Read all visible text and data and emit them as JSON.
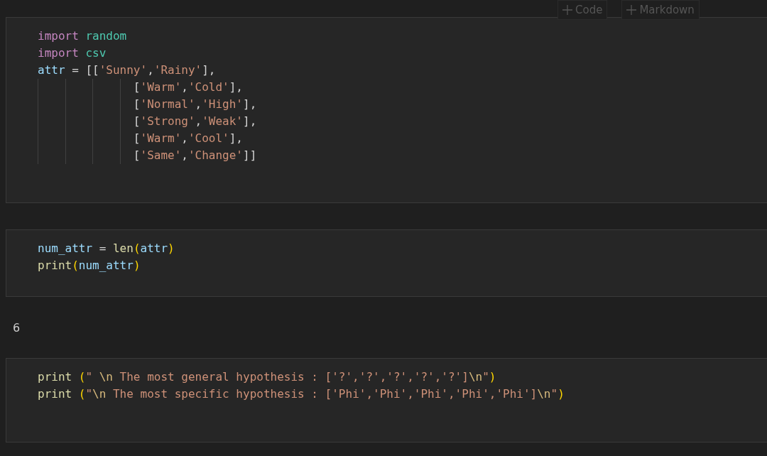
{
  "toolbar": {
    "buttons": [
      {
        "label": "Code"
      },
      {
        "label": "Markdown"
      }
    ]
  },
  "cells": [
    {
      "lines": [
        [
          {
            "text": "import ",
            "kind": "keyword"
          },
          {
            "text": "random",
            "kind": "module"
          }
        ],
        [
          {
            "text": "import ",
            "kind": "keyword"
          },
          {
            "text": "csv",
            "kind": "module"
          }
        ],
        [
          {
            "text": "attr",
            "kind": "variable"
          },
          {
            "text": " = [[",
            "kind": "plain"
          },
          {
            "text": "'Sunny'",
            "kind": "string"
          },
          {
            "text": ",",
            "kind": "plain"
          },
          {
            "text": "'Rainy'",
            "kind": "string"
          },
          {
            "text": "],",
            "kind": "plain"
          }
        ],
        [
          {
            "text": "              [",
            "kind": "plain"
          },
          {
            "text": "'Warm'",
            "kind": "string"
          },
          {
            "text": ",",
            "kind": "plain"
          },
          {
            "text": "'Cold'",
            "kind": "string"
          },
          {
            "text": "],",
            "kind": "plain"
          }
        ],
        [
          {
            "text": "              [",
            "kind": "plain"
          },
          {
            "text": "'Normal'",
            "kind": "string"
          },
          {
            "text": ",",
            "kind": "plain"
          },
          {
            "text": "'High'",
            "kind": "string"
          },
          {
            "text": "],",
            "kind": "plain"
          }
        ],
        [
          {
            "text": "              [",
            "kind": "plain"
          },
          {
            "text": "'Strong'",
            "kind": "string"
          },
          {
            "text": ",",
            "kind": "plain"
          },
          {
            "text": "'Weak'",
            "kind": "string"
          },
          {
            "text": "],",
            "kind": "plain"
          }
        ],
        [
          {
            "text": "              [",
            "kind": "plain"
          },
          {
            "text": "'Warm'",
            "kind": "string"
          },
          {
            "text": ",",
            "kind": "plain"
          },
          {
            "text": "'Cool'",
            "kind": "string"
          },
          {
            "text": "],",
            "kind": "plain"
          }
        ],
        [
          {
            "text": "              [",
            "kind": "plain"
          },
          {
            "text": "'Same'",
            "kind": "string"
          },
          {
            "text": ",",
            "kind": "plain"
          },
          {
            "text": "'Change'",
            "kind": "string"
          },
          {
            "text": "]]",
            "kind": "plain"
          }
        ]
      ]
    },
    {
      "lines": [
        [
          {
            "text": "num_attr",
            "kind": "variable"
          },
          {
            "text": " = ",
            "kind": "plain"
          },
          {
            "text": "len",
            "kind": "function"
          },
          {
            "text": "(",
            "kind": "bracket"
          },
          {
            "text": "attr",
            "kind": "variable"
          },
          {
            "text": ")",
            "kind": "bracket"
          }
        ],
        [
          {
            "text": "print",
            "kind": "function"
          },
          {
            "text": "(",
            "kind": "bracket"
          },
          {
            "text": "num_attr",
            "kind": "variable"
          },
          {
            "text": ")",
            "kind": "bracket"
          }
        ]
      ],
      "output": "6"
    },
    {
      "lines": [
        [
          {
            "text": "print ",
            "kind": "function"
          },
          {
            "text": "(",
            "kind": "bracket"
          },
          {
            "text": "\" ",
            "kind": "string"
          },
          {
            "text": "\\n",
            "kind": "escape"
          },
          {
            "text": " The most general hypothesis : ['?','?','?','?','?']",
            "kind": "string"
          },
          {
            "text": "\\n",
            "kind": "escape"
          },
          {
            "text": "\"",
            "kind": "string"
          },
          {
            "text": ")",
            "kind": "bracket"
          }
        ],
        [
          {
            "text": "print ",
            "kind": "function"
          },
          {
            "text": "(",
            "kind": "bracket"
          },
          {
            "text": "\"",
            "kind": "string"
          },
          {
            "text": "\\n",
            "kind": "escape"
          },
          {
            "text": " The most specific hypothesis : ['Phi','Phi','Phi','Phi','Phi']",
            "kind": "string"
          },
          {
            "text": "\\n",
            "kind": "escape"
          },
          {
            "text": "\"",
            "kind": "string"
          },
          {
            "text": ")",
            "kind": "bracket"
          }
        ]
      ]
    }
  ]
}
